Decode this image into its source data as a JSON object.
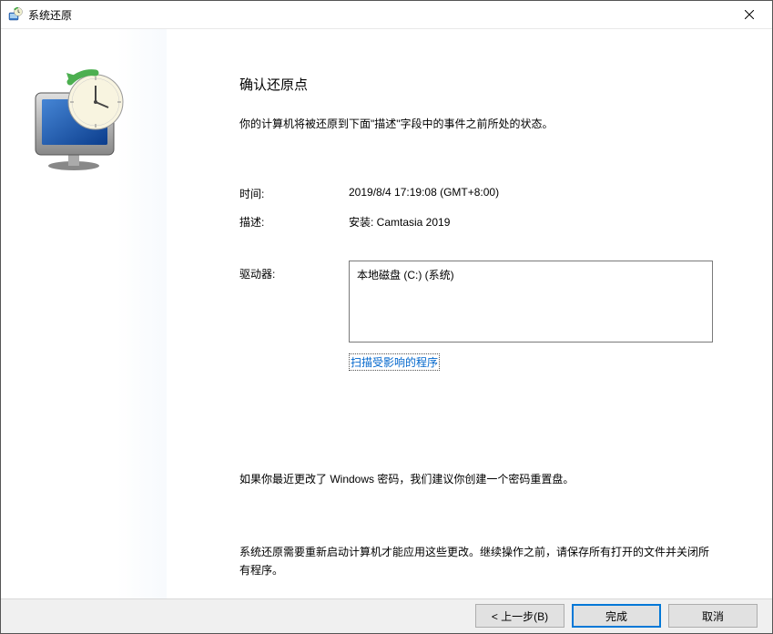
{
  "window": {
    "title": "系统还原"
  },
  "main": {
    "heading": "确认还原点",
    "subtext": "你的计算机将被还原到下面\"描述\"字段中的事件之前所处的状态。",
    "time_label": "时间:",
    "time_value": "2019/8/4 17:19:08 (GMT+8:00)",
    "desc_label": "描述:",
    "desc_value": "安装: Camtasia 2019",
    "drives_label": "驱动器:",
    "drives_value": "本地磁盘 (C:) (系统)",
    "scan_link": "扫描受影响的程序",
    "note_password": "如果你最近更改了 Windows 密码，我们建议你创建一个密码重置盘。",
    "note_restart": "系统还原需要重新启动计算机才能应用这些更改。继续操作之前，请保存所有打开的文件并关闭所有程序。"
  },
  "footer": {
    "back": "< 上一步(B)",
    "finish": "完成",
    "cancel": "取消"
  }
}
